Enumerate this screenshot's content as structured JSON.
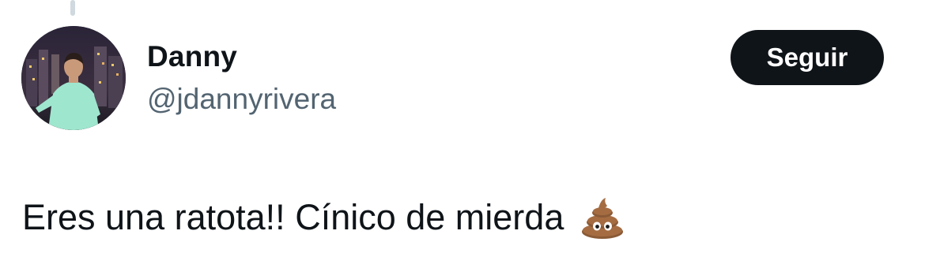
{
  "tweet": {
    "author": {
      "display_name": "Danny",
      "handle": "@jdannyrivera",
      "avatar": "user-avatar-photo"
    },
    "follow_button": {
      "label": "Seguir"
    },
    "text": "Eres una ratota!! Cínico de mierda",
    "emoji": "pile-of-poo-icon"
  },
  "colors": {
    "text_primary": "#0f1419",
    "text_secondary": "#536471",
    "button_bg": "#0f1419",
    "button_text": "#ffffff",
    "thread_line": "#cfd9de"
  }
}
